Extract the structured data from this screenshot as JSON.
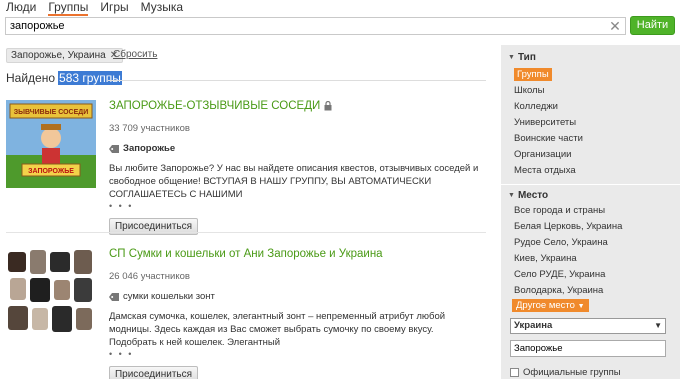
{
  "tabs": [
    "Люди",
    "Группы",
    "Игры",
    "Музыка"
  ],
  "search": {
    "value": "запорожье",
    "button": "Найти"
  },
  "filter": {
    "chip": "Запорожье, Украина",
    "reset": "Сбросить"
  },
  "found": {
    "prefix": "Найдено",
    "count": "583 группы"
  },
  "results": [
    {
      "title": "ЗАПОРОЖЬЕ-ОТЗЫВЧИВЫЕ СОСЕДИ",
      "members": "33 709 участников",
      "tag": "Запорожье",
      "description": "Вы любите Запорожье? У нас вы найдете описания квестов, отзывчивых соседей и свободное общение! ВСТУПАЯ В НАШУ ГРУППУ, ВЫ АВТОМАТИЧЕСКИ СОГЛАШАЕТЕСЬ С НАШИМИ",
      "thumb_text": [
        "ЗЫВЧИВЫЕ СОСЕДИ",
        "ЗАПОРОЖЬЕ"
      ],
      "join": "Присоединиться"
    },
    {
      "title": "СП Сумки и кошельки от Ани Запорожье и Украина",
      "members": "26 046 участников",
      "tag": "сумки кошельки зонт",
      "description": "Дамская сумочка, кошелек, элегантный зонт – непременный атрибут любой модницы. Здесь каждая из Вас сможет выбрать сумочку по своему вкусу. Подобрать к ней кошелек. Элегантный",
      "join": "Присоединиться"
    }
  ],
  "sidebar": {
    "type_label": "Тип",
    "type_items": [
      "Группы",
      "Школы",
      "Колледжи",
      "Университеты",
      "Воинские части",
      "Организации",
      "Места отдыха"
    ],
    "place_label": "Место",
    "place_items": [
      "Все города и страны",
      "Белая Церковь, Украина",
      "Рудое Село, Украина",
      "Киев, Украина",
      "Село РУДЕ, Украина",
      "Володарка, Украина"
    ],
    "other_place": "Другое место",
    "country": "Украина",
    "city": "Запорожье",
    "official": "Официальные группы"
  },
  "colors": {
    "accent": "#eb722e",
    "link_green": "#4a9a16",
    "button_green": "#4fb329",
    "highlight": "#3d7bd4"
  }
}
